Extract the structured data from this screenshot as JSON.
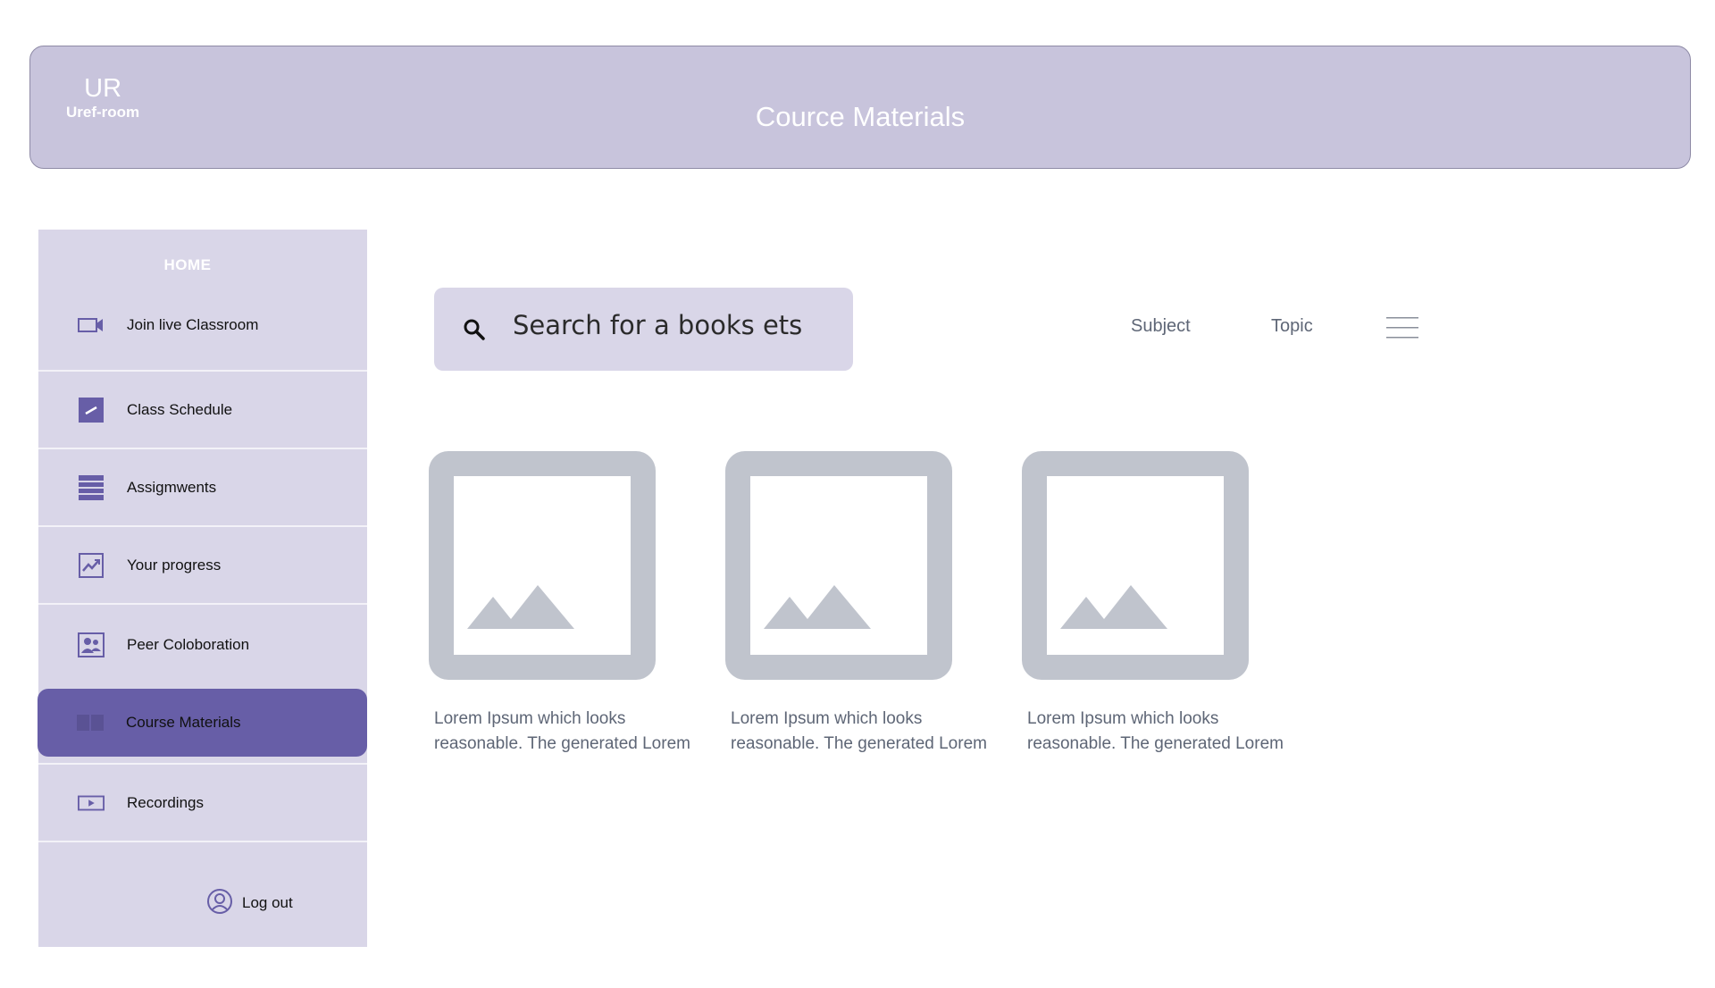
{
  "header": {
    "logo_mark": "UR",
    "logo_name": "Uref-room",
    "title": "Cource Materials"
  },
  "sidebar": {
    "home_label": "HOME",
    "items": [
      {
        "label": "Join live Classroom",
        "icon": "video-camera-icon",
        "active": false
      },
      {
        "label": "Class Schedule",
        "icon": "calendar-edit-icon",
        "active": false
      },
      {
        "label": "Assigmwents",
        "icon": "list-icon",
        "active": false
      },
      {
        "label": "Your progress",
        "icon": "chart-trend-icon",
        "active": false
      },
      {
        "label": "Peer Coloboration",
        "icon": "people-icon",
        "active": false
      },
      {
        "label": "Course Materials",
        "icon": "book-icon",
        "active": true
      },
      {
        "label": "Recordings",
        "icon": "play-icon",
        "active": false
      }
    ],
    "logout_label": "Log out"
  },
  "search": {
    "placeholder": "Search for a books ets"
  },
  "filters": {
    "subject": "Subject",
    "topic": "Topic"
  },
  "cards": [
    {
      "caption_line1": "Lorem Ipsum which looks",
      "caption_line2": "reasonable. The generated Lorem"
    },
    {
      "caption_line1": "Lorem Ipsum which looks",
      "caption_line2": "reasonable. The generated Lorem"
    },
    {
      "caption_line1": "Lorem Ipsum which looks",
      "caption_line2": "reasonable. The generated Lorem"
    }
  ],
  "colors": {
    "header_bg": "#c8c4dc",
    "sidebar_bg": "#d9d6e8",
    "accent": "#675ea7",
    "placeholder_gray": "#c0c4cd",
    "muted_text": "#5e6676"
  }
}
